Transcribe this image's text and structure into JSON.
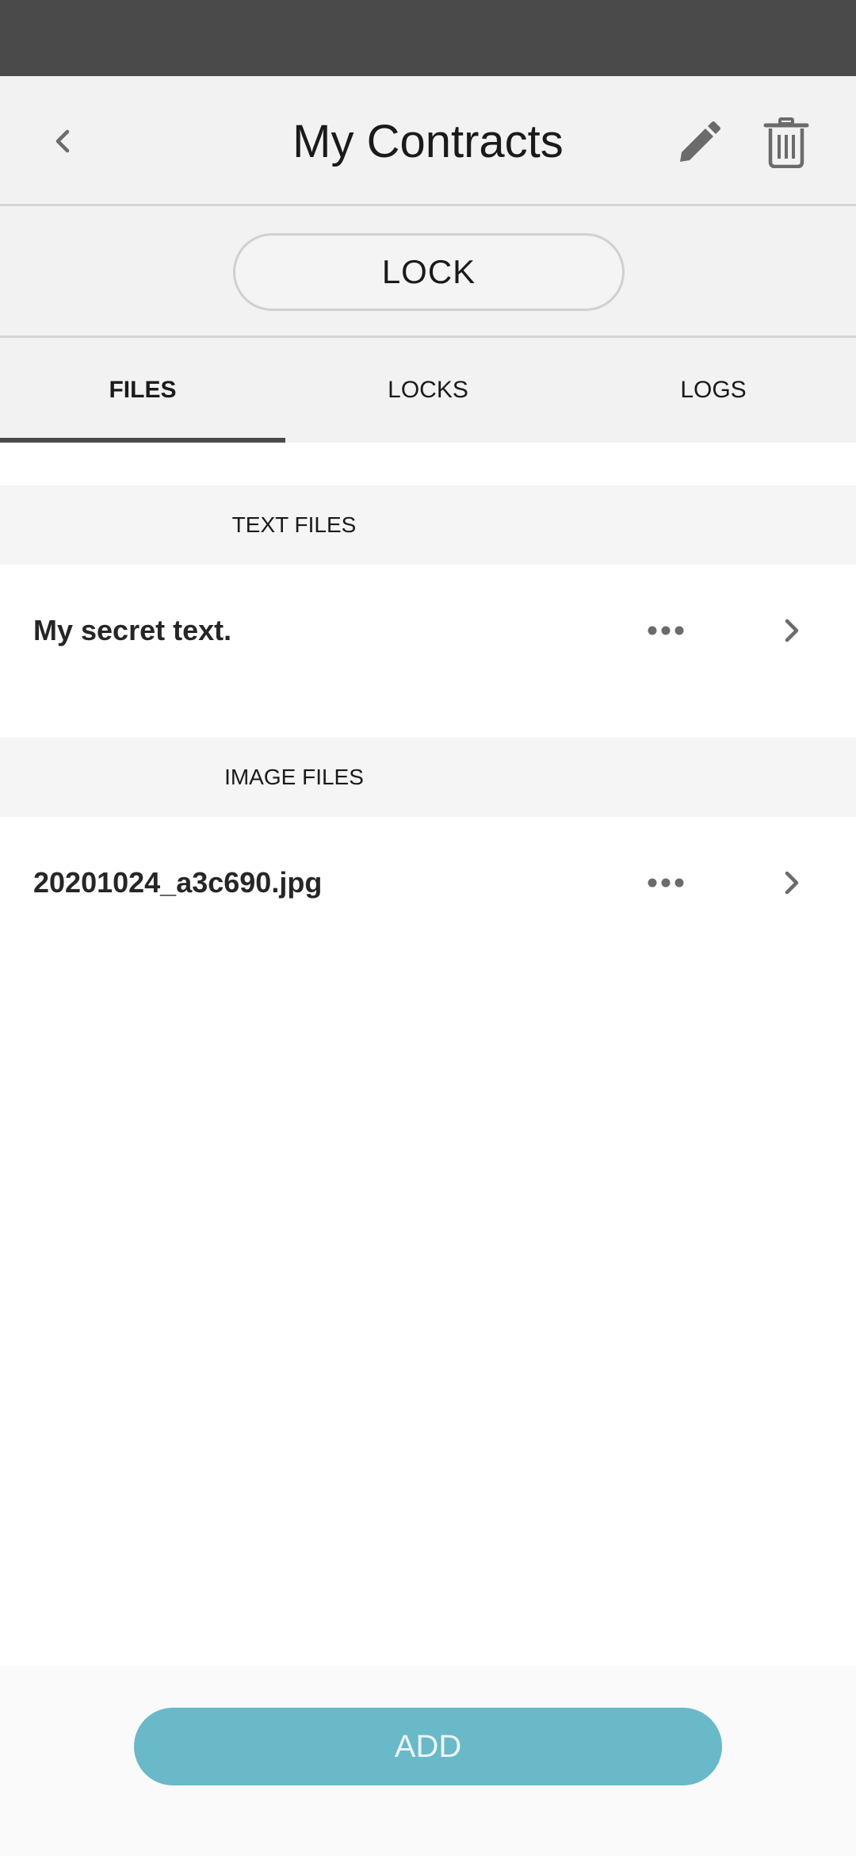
{
  "header": {
    "title": "My Contracts"
  },
  "lock_button": {
    "label": "LOCK"
  },
  "tabs": [
    {
      "label": "FILES",
      "active": true
    },
    {
      "label": "LOCKS",
      "active": false
    },
    {
      "label": "LOGS",
      "active": false
    }
  ],
  "sections": [
    {
      "title": "TEXT FILES",
      "items": [
        {
          "name": "My secret text."
        }
      ]
    },
    {
      "title": "IMAGE FILES",
      "items": [
        {
          "name": "20201024_a3c690.jpg"
        }
      ]
    }
  ],
  "add_button": {
    "label": "ADD"
  },
  "colors": {
    "status_bar": "#4a4a4a",
    "app_bar": "#f2f2f2",
    "accent": "#69b9c8",
    "icon": "#6b6b6b"
  },
  "icons": {
    "back": "chevron-left-icon",
    "edit": "pencil-icon",
    "delete": "trash-icon",
    "more": "more-horizontal-icon",
    "open": "chevron-right-icon"
  }
}
